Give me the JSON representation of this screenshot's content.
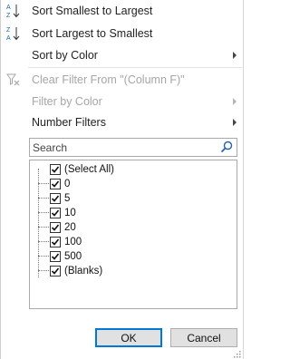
{
  "menu": {
    "sort_asc": {
      "label": "Sort Smallest to Largest",
      "icon": "sort-ascending-icon"
    },
    "sort_desc": {
      "label": "Sort Largest to Smallest",
      "icon": "sort-descending-icon"
    },
    "sort_color": {
      "label": "Sort by Color"
    },
    "clear_filter": {
      "label": "Clear Filter From \"(Column F)\"",
      "icon": "clear-filter-icon"
    },
    "filter_color": {
      "label": "Filter by Color"
    },
    "number_filters": {
      "label": "Number Filters"
    }
  },
  "search": {
    "placeholder": "Search",
    "icon": "search-icon"
  },
  "values": [
    {
      "label": "(Select All)",
      "checked": true
    },
    {
      "label": "0",
      "checked": true
    },
    {
      "label": "5",
      "checked": true
    },
    {
      "label": "10",
      "checked": true
    },
    {
      "label": "20",
      "checked": true
    },
    {
      "label": "100",
      "checked": true
    },
    {
      "label": "500",
      "checked": true
    },
    {
      "label": "(Blanks)",
      "checked": true
    }
  ],
  "buttons": {
    "ok": "OK",
    "cancel": "Cancel"
  },
  "colors": {
    "accent": "#0078d7",
    "disabled_text": "#a6a6a6",
    "az_blue": "#1e62b4"
  }
}
